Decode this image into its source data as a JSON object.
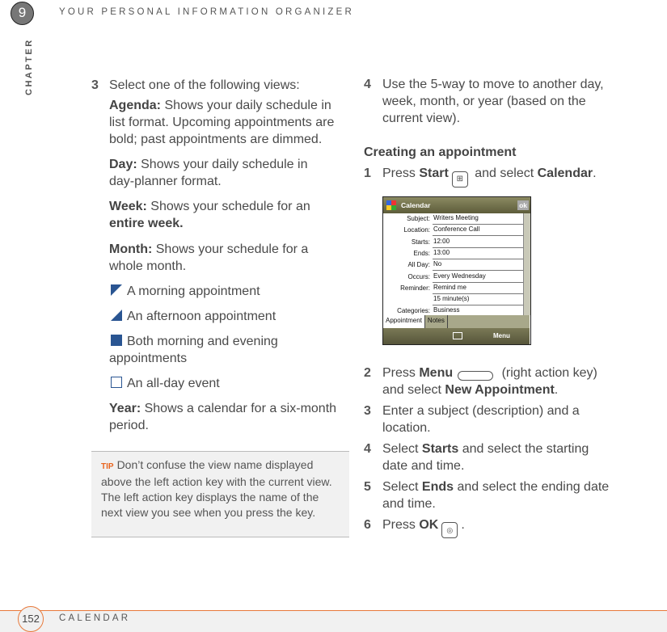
{
  "header": {
    "chapter_number": "9",
    "chapter_label": "CHAPTER",
    "title": "YOUR PERSONAL INFORMATION ORGANIZER"
  },
  "footer": {
    "page_number": "152",
    "section": "CALENDAR"
  },
  "left": {
    "step3": {
      "num": "3",
      "text": "Select one of the following views:"
    },
    "agenda": {
      "label": "Agenda:",
      "l1": " Shows your daily schedule in",
      "l2": "list format. Upcoming appointments are",
      "l3": "bold; past appointments are dimmed."
    },
    "day": {
      "label": "Day:",
      "l1": " Shows your daily schedule in",
      "l2": "day-planner format."
    },
    "week": {
      "label": "Week:",
      "l1": " Shows your schedule for an",
      "l2": "entire week."
    },
    "month": {
      "label": "Month:",
      "l1": " Shows your schedule for a",
      "l2": "whole month."
    },
    "legend": {
      "morning": "A morning appointment",
      "afternoon": "An afternoon appointment",
      "both_l1": "Both morning and evening",
      "both_l2": "appointments",
      "allday": "An all-day event"
    },
    "year": {
      "label": "Year:",
      "l1": " Shows a calendar for a six-month",
      "l2": "period."
    },
    "tip": {
      "label": "TIP",
      "text": "Don’t confuse the view name displayed above the left action key with the current view. The left action key displays the name of the next view you see when you press the key."
    }
  },
  "right": {
    "step4": {
      "num": "4",
      "l1": "Use the 5-way to move to another day,",
      "l2": "week, month, or year (based on the",
      "l3": "current view)."
    },
    "heading": "Creating an appointment",
    "s1": {
      "num": "1",
      "a": "Press ",
      "b": "Start",
      "c": " and select ",
      "d": "Calendar",
      "e": "."
    },
    "s2": {
      "num": "2",
      "a": "Press ",
      "b": "Menu",
      "c": " (right action key)",
      "l2a": "and select ",
      "l2b": "New Appointment",
      "l2c": "."
    },
    "s3": {
      "num": "3",
      "l1": "Enter a subject (description) and a",
      "l2": "location."
    },
    "s4": {
      "num": "4",
      "a": "Select ",
      "b": "Starts",
      "c": " and select the starting",
      "l2": "date and time."
    },
    "s5": {
      "num": "5",
      "a": "Select ",
      "b": "Ends",
      "c": " and select the ending date",
      "l2": "and time."
    },
    "s6": {
      "num": "6",
      "a": "Press ",
      "b": "OK",
      "c": "."
    }
  },
  "device": {
    "title": "Calendar",
    "ok": "ok",
    "fields": [
      {
        "label": "Subject:",
        "value": "Writers Meeting"
      },
      {
        "label": "Location:",
        "value": "Conference Call"
      },
      {
        "label": "Starts:",
        "value": "12:00"
      },
      {
        "label": "Ends:",
        "value": "13:00"
      },
      {
        "label": "All Day:",
        "value": "No"
      },
      {
        "label": "Occurs:",
        "value": "Every Wednesday"
      },
      {
        "label": "Reminder:",
        "value": "Remind me"
      },
      {
        "label": "",
        "value": "15      minute(s)"
      },
      {
        "label": "Categories:",
        "value": "Business"
      }
    ],
    "tabs": [
      "Appointment",
      "Notes"
    ],
    "menu": "Menu"
  },
  "colors": {
    "accent": "#e8793a",
    "icon_blue": "#2a5592",
    "text": "#4a4a4a"
  }
}
